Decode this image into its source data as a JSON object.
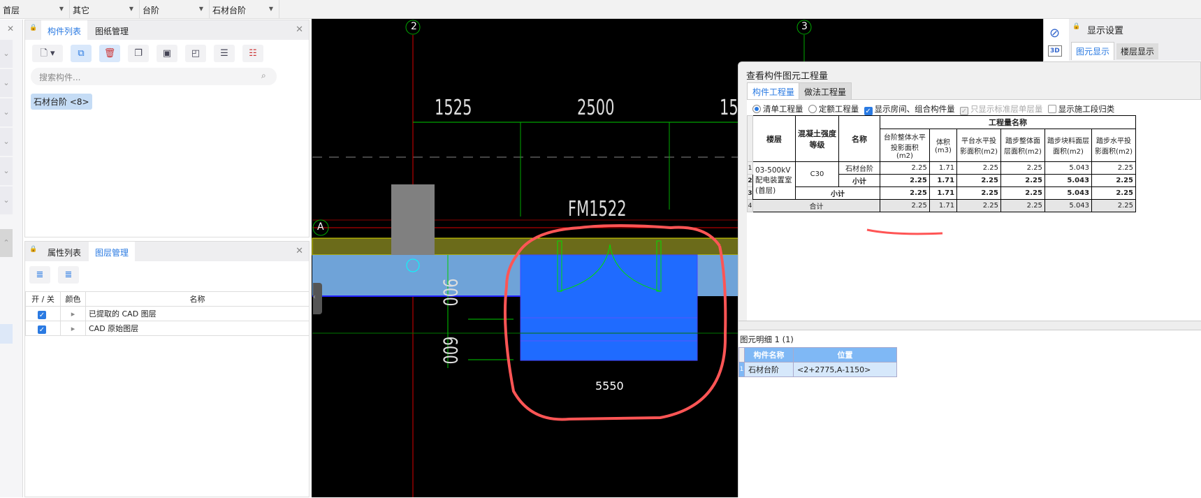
{
  "topbar": {
    "dropdowns": [
      "首层",
      "其它",
      "台阶",
      "石材台阶"
    ]
  },
  "component_panel": {
    "tabs": [
      "构件列表",
      "图纸管理"
    ],
    "search_placeholder": "搜索构件...",
    "items": [
      "石材台阶 <8>"
    ]
  },
  "layer_panel": {
    "tabs": [
      "属性列表",
      "图层管理"
    ],
    "columns": [
      "开 / 关",
      "颜色",
      "名称"
    ],
    "rows": [
      {
        "on": true,
        "name": "已提取的 CAD 图层"
      },
      {
        "on": true,
        "name": "CAD 原始图层"
      }
    ]
  },
  "cad": {
    "axis_labels": [
      "2",
      "3",
      "A"
    ],
    "dimensions": [
      "1525",
      "2500",
      "15",
      "900",
      "600"
    ],
    "door_label": "FM1522",
    "text_5550": "5550"
  },
  "display_panel": {
    "title": "显示设置",
    "tabs": [
      "图元显示",
      "楼层显示"
    ]
  },
  "side_toolbar": {
    "label_3d": "3D"
  },
  "dialog": {
    "title": "查看构件图元工程量",
    "tabs": [
      "构件工程量",
      "做法工程量"
    ],
    "options": {
      "qd": "清单工程量",
      "de": "定额工程量",
      "show_room": "显示房间、组合构件量",
      "std_floor": "只显示标准层单层量",
      "show_stage": "显示施工段归类"
    },
    "table": {
      "headers": {
        "floor": "楼层",
        "grade": "混凝土强度等级",
        "name": "名称",
        "group": "工程量名称",
        "cols": [
          "台阶整体水平投影面积(m2)",
          "体积(m3)",
          "平台水平投影面积(m2)",
          "踏步整体面层面积(m2)",
          "踏步块料面层面积(m2)",
          "踏步水平投影面积(m2)"
        ]
      },
      "row_numbers": [
        "1",
        "2",
        "3",
        "4"
      ],
      "floor": "03-500kV配电装置室(首层)",
      "grade": "C30",
      "rows": [
        {
          "name": "石材台阶",
          "values": [
            "2.25",
            "1.71",
            "2.25",
            "2.25",
            "5.043",
            "2.25"
          ]
        },
        {
          "name": "小计",
          "values": [
            "2.25",
            "1.71",
            "2.25",
            "2.25",
            "5.043",
            "2.25"
          ]
        },
        {
          "name": "小计",
          "values": [
            "2.25",
            "1.71",
            "2.25",
            "2.25",
            "5.043",
            "2.25"
          ]
        },
        {
          "name": "合计",
          "values": [
            "2.25",
            "1.71",
            "2.25",
            "2.25",
            "5.043",
            "2.25"
          ]
        }
      ]
    },
    "detail": {
      "title": "图元明细  1 (1)",
      "columns": [
        "构件名称",
        "位置"
      ],
      "rows": [
        {
          "n": "1",
          "name": "石材台阶",
          "pos": "<2+2775,A-1150>"
        }
      ]
    }
  }
}
